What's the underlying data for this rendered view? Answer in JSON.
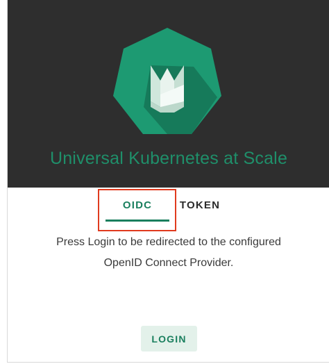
{
  "header": {
    "title": "Universal Kubernetes at Scale",
    "logo_icon": "tulip-heptagon-logo-icon"
  },
  "tabs": [
    {
      "label": "OIDC",
      "active": true
    },
    {
      "label": "TOKEN",
      "active": false
    }
  ],
  "message": {
    "line1": "Press Login to be redirected to the configured",
    "line2": "OpenID Connect Provider."
  },
  "login_button": {
    "label": "LOGIN"
  },
  "colors": {
    "header_bg": "#2e2e2e",
    "brand_green": "#1a7f5e",
    "logo_green": "#1d9a72",
    "highlight_red": "#e03a1e",
    "button_bg": "#e3f1ea"
  }
}
